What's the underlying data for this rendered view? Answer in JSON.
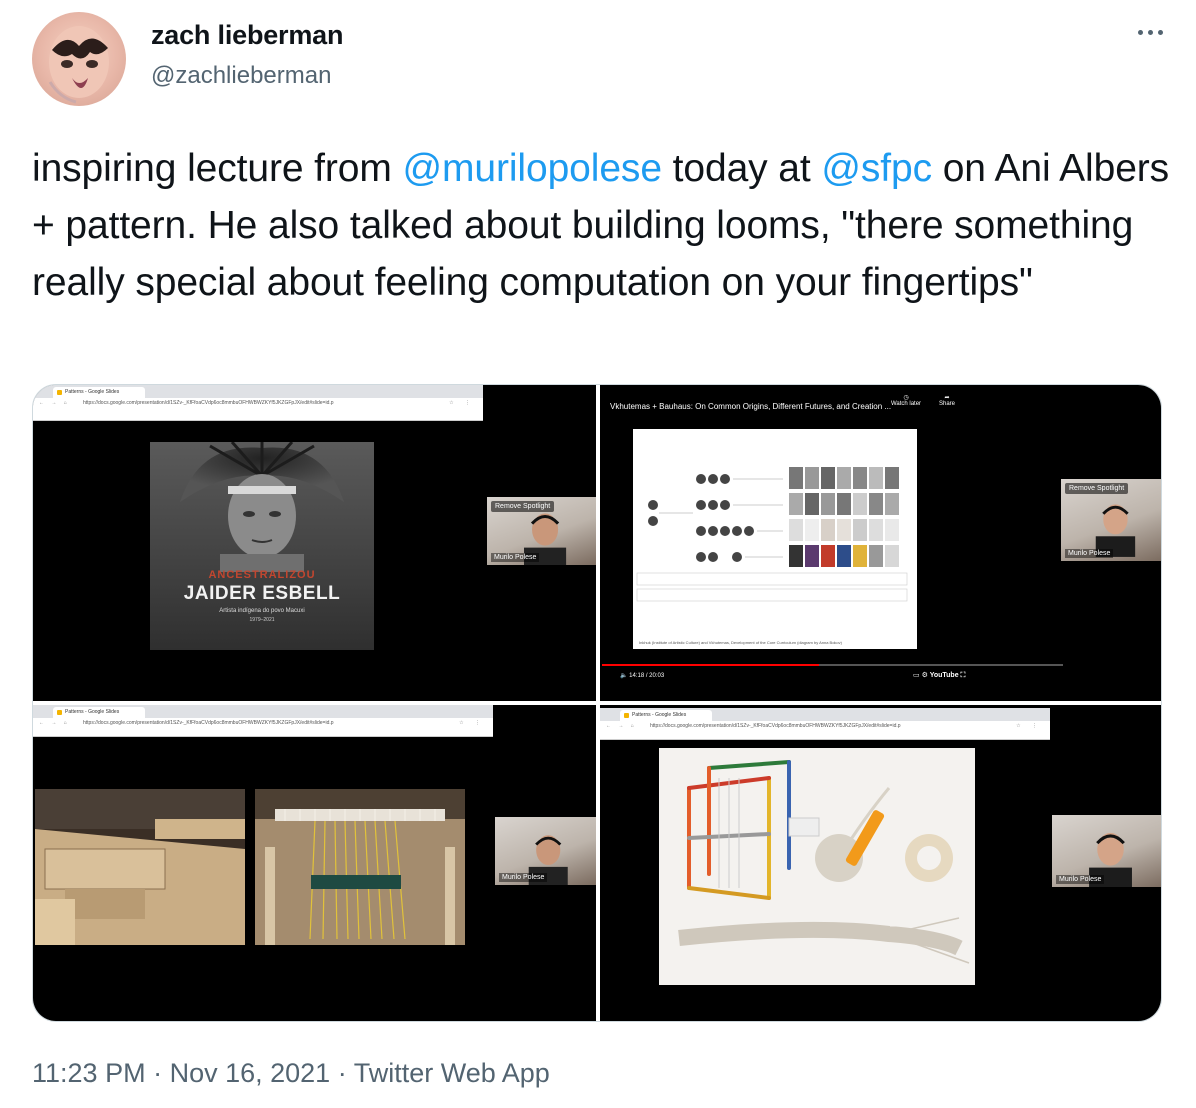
{
  "user": {
    "display_name": "zach lieberman",
    "handle": "@zachlieberman"
  },
  "tweet": {
    "text_1": "inspiring lecture from ",
    "mention_1": "@murilopolese",
    "text_2": " today at ",
    "mention_2": "@sfpc",
    "text_3": " on Ani Albers + pattern.  He also talked about building looms, \"there something really special about feeling computation on your fingertips\""
  },
  "media": {
    "screenshot_1": {
      "tab_label": "Patterns - Google Slides",
      "url": "https://docs.google.com/presentation/d/1SZv-_KfFfoaCVdp6oc8mmbuOFHWBWZKYf5JKZGFpJX/edit#slide=id.p",
      "poster_kicker": "ANCESTRALIZOU",
      "poster_title": "JAIDER ESBELL",
      "poster_subtitle": "Artista indígena do povo Macuxi",
      "poster_years": "1979–2021",
      "spotlight_label": "Remove Spotlight",
      "participant_name": "Murilo Polese"
    },
    "screenshot_2": {
      "video_title": "Vkhutemas + Bauhaus: On Common Origins, Different Futures, and Creation ...",
      "watch_later": "Watch later",
      "share": "Share",
      "caption": "Inkhuk (Institute of Artistic Culture) and Vkhutemas, Development of the Core Curriculum (diagram by Anna Bokov)",
      "time": "14:18 / 20:03",
      "platform": "YouTube",
      "spotlight_label": "Remove Spotlight",
      "participant_name": "Murilo Polese"
    },
    "screenshot_3": {
      "tab_label": "Patterns - Google Slides",
      "url": "https://docs.google.com/presentation/d/1SZv-_KfFfoaCVdp6oc8mmbuOFHWBWZKYf5JKZGFpJX/edit#slide=id.p",
      "participant_name": "Murilo Polese"
    },
    "screenshot_4": {
      "tab_label": "Patterns - Google Slides",
      "url": "https://docs.google.com/presentation/d/1SZv-_KfFfoaCVdp6oc8mmbuOFHWBWZKYf5JKZGFpJX/edit#slide=id.p",
      "participant_name": "Murilo Polese"
    }
  },
  "meta": {
    "time": "11:23 PM",
    "date": "Nov 16, 2021",
    "source": "Twitter Web App"
  },
  "colors": {
    "accent": "#1d9bf0",
    "text_primary": "#0f1419",
    "text_secondary": "#536471"
  },
  "icons": {
    "more": "more-horizontal-icon"
  }
}
